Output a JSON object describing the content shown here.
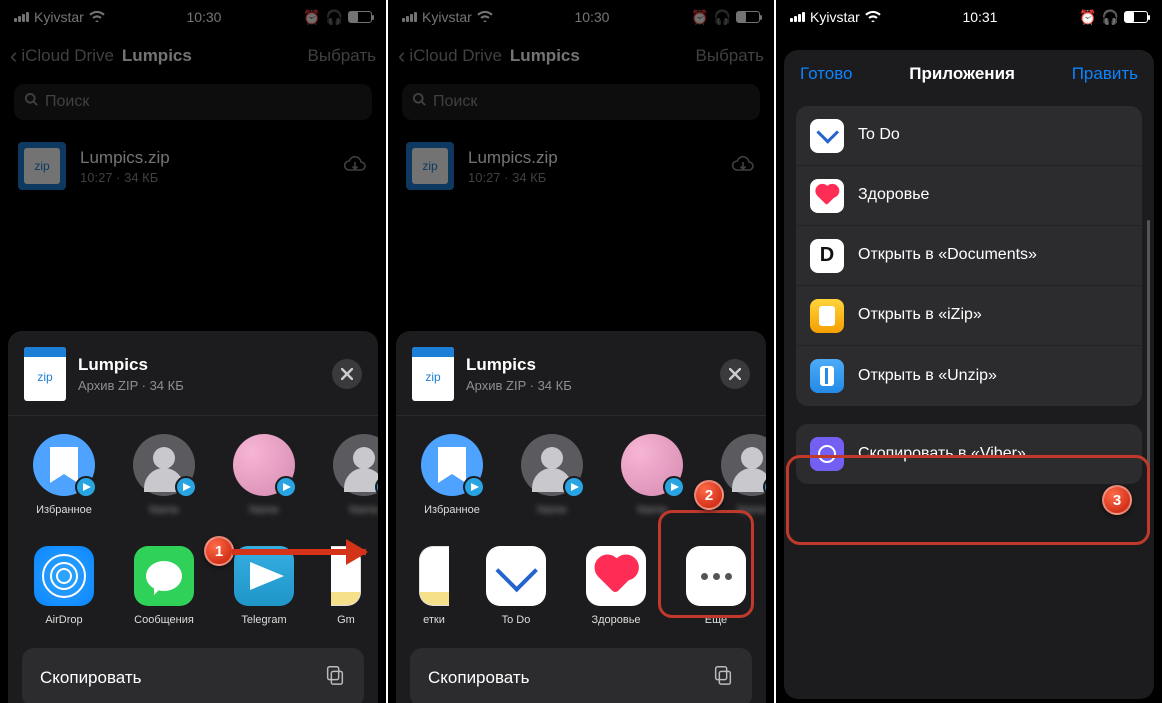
{
  "status": {
    "carrier": "Kyivstar",
    "time1": "10:30",
    "time2": "10:31"
  },
  "nav": {
    "back": "iCloud Drive",
    "title": "Lumpics",
    "select": "Выбрать",
    "search": "Поиск"
  },
  "file": {
    "name": "Lumpics.zip",
    "meta": "10:27 · 34 КБ",
    "zip_label": "zip"
  },
  "share": {
    "title": "Lumpics",
    "subtitle": "Архив ZIP · 34 КБ",
    "contacts": {
      "favorite": "Избранное"
    },
    "apps1": {
      "airdrop": "AirDrop",
      "messages": "Сообщения",
      "telegram": "Telegram",
      "notes_clip": "Gm"
    },
    "apps2": {
      "notes": "етки",
      "todo": "To Do",
      "health": "Здоровье",
      "more": "Еще"
    },
    "copy": "Скопировать"
  },
  "appsheet": {
    "done": "Готово",
    "title": "Приложения",
    "edit": "Править",
    "items": {
      "todo": "To Do",
      "health": "Здоровье",
      "docs": "Открыть в «Documents»",
      "izip": "Открыть в «iZip»",
      "unzip": "Открыть в «Unzip»",
      "viber": "Скопировать в «Viber»"
    }
  },
  "steps": {
    "s1": "1",
    "s2": "2",
    "s3": "3"
  }
}
